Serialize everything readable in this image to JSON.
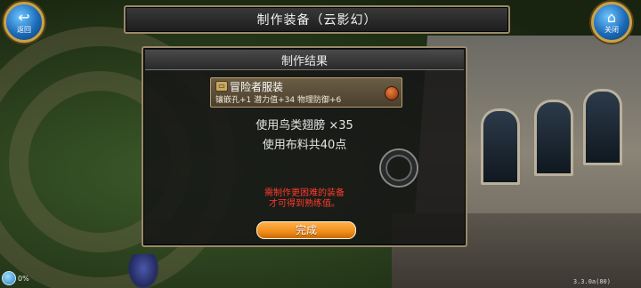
{
  "hud": {
    "back_label": "返回",
    "close_label": "关闭",
    "progress": "0%",
    "version": "3.3.0a(80)"
  },
  "dialog": {
    "title": "制作装备（云影幻）",
    "panel_title": "制作结果",
    "item": {
      "name": "冒险者服装",
      "stats": "镶嵌孔+1  潜力值+34  物理防御+6"
    },
    "use_line_1": "使用鸟类翅膀 ×35",
    "use_line_2": "使用布料共40点",
    "notice_line_1": "需制作更困难的装备",
    "notice_line_2": "才可得到熟练值。",
    "finish_label": "完成"
  }
}
